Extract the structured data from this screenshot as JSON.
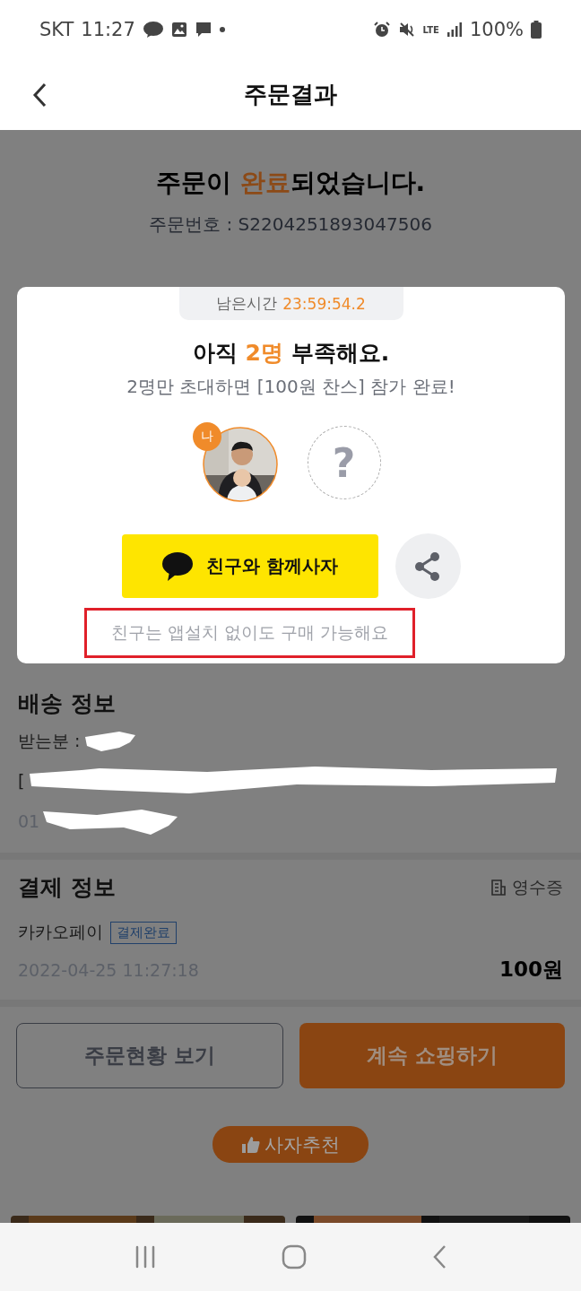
{
  "status_bar": {
    "carrier": "SKT",
    "time": "11:27",
    "network": "LTE",
    "battery": "100%"
  },
  "header": {
    "title": "주문결과"
  },
  "order": {
    "title_parts": [
      {
        "text": "주문이 ",
        "highlight": false
      },
      {
        "text": "완료",
        "highlight": true
      },
      {
        "text": "되었습니다.",
        "highlight": false
      }
    ],
    "order_number": "주문번호 : S2204251893047506"
  },
  "invite_modal": {
    "timer_label": "남은시간",
    "timer": "23:59:54.2",
    "heading_parts": [
      {
        "text": "아직 ",
        "highlight": false
      },
      {
        "text": "2명",
        "highlight": true
      },
      {
        "text": " 부족해요.",
        "highlight": false
      }
    ],
    "subtitle": "2명만 초대하면 [100원 찬스] 참가 완료!",
    "participants": [
      {
        "kind": "me",
        "badge": "나"
      },
      {
        "kind": "empty",
        "mark": "?"
      }
    ],
    "invite_button": "친구와 함께사자",
    "note": "친구는 앱설치 없이도 구매 가능해요"
  },
  "delivery": {
    "title": "배송 정보",
    "recipient_label": "받는분 :",
    "address_visible": "[",
    "phone_visible": "01"
  },
  "payment": {
    "title": "결제 정보",
    "receipt_link": "영수증",
    "method": "카카오페이",
    "status_badge": "결제완료",
    "datetime": "2022-04-25 11:27:18",
    "amount": "100원"
  },
  "actions": [
    {
      "label": "주문현황 보기",
      "kind": "outline"
    },
    {
      "label": "계속 쇼핑하기",
      "kind": "filled"
    }
  ],
  "recommend": {
    "label": "사자추천"
  }
}
